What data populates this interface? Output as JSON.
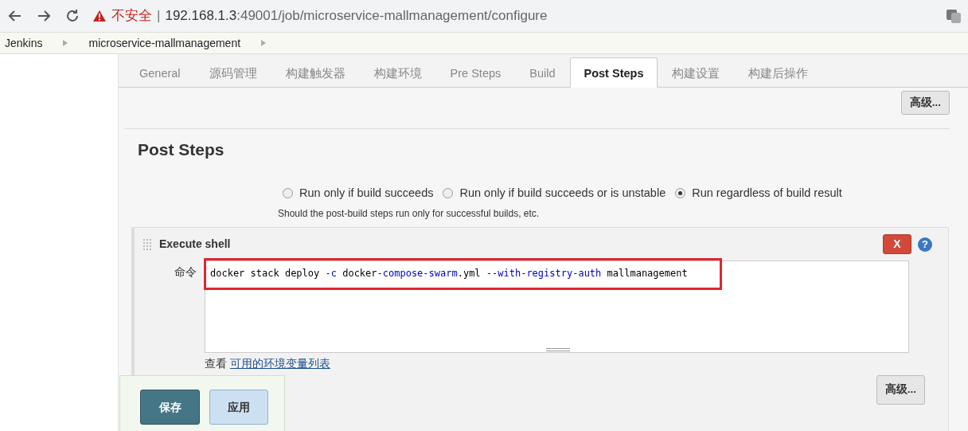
{
  "browser": {
    "security_label": "不安全",
    "separator": "|",
    "url_host": "192.168.1.3",
    "url_rest": ":49001/job/microservice-mallmanagement/configure"
  },
  "breadcrumbs": [
    "Jenkins",
    "microservice-mallmanagement"
  ],
  "tabs": [
    {
      "label": "General",
      "selected": false
    },
    {
      "label": "源码管理",
      "selected": false
    },
    {
      "label": "构建触发器",
      "selected": false
    },
    {
      "label": "构建环境",
      "selected": false
    },
    {
      "label": "Pre Steps",
      "selected": false
    },
    {
      "label": "Build",
      "selected": false
    },
    {
      "label": "Post Steps",
      "selected": true
    },
    {
      "label": "构建设置",
      "selected": false
    },
    {
      "label": "构建后操作",
      "selected": false
    }
  ],
  "top_advanced_button": "高级...",
  "section": {
    "title": "Post Steps",
    "run_options": [
      {
        "label": "Run only if build succeeds",
        "selected": false
      },
      {
        "label": "Run only if build succeeds or is unstable",
        "selected": false
      },
      {
        "label": "Run regardless of build result",
        "selected": true
      }
    ],
    "hint": "Should the post-build steps run only for successful builds, etc."
  },
  "step": {
    "title": "Execute shell",
    "delete_label": "X",
    "help_label": "?",
    "command_label": "命令",
    "command": [
      {
        "text": "docker stack deploy ",
        "kind": "plain"
      },
      {
        "text": "-c",
        "kind": "option"
      },
      {
        "text": " docker",
        "kind": "plain"
      },
      {
        "text": "-compose-swarm",
        "kind": "option"
      },
      {
        "text": ".yml ",
        "kind": "plain"
      },
      {
        "text": "--with-registry-auth",
        "kind": "option"
      },
      {
        "text": " mallmanagement",
        "kind": "plain"
      }
    ],
    "env_prefix": "查看",
    "env_link": "可用的环境变量列表",
    "advanced_button": "高级..."
  },
  "footer_buttons": [
    {
      "label": "保存",
      "kind": "primary"
    },
    {
      "label": "应用",
      "kind": "secondary"
    }
  ]
}
